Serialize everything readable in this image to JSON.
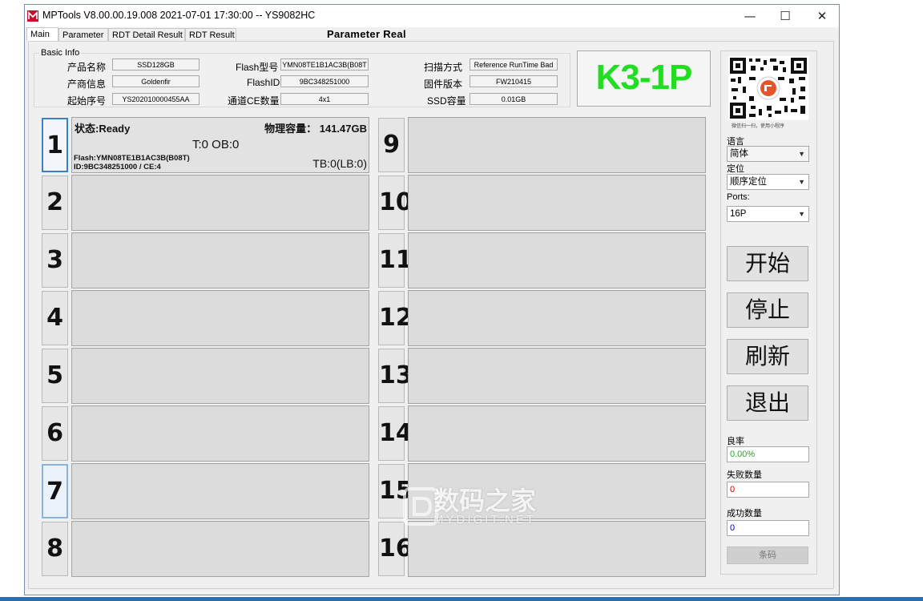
{
  "window": {
    "title": "MPTools V8.00.00.19.008 2021-07-01 17:30:00  -- YS9082HC",
    "controls": {
      "minimize": "—",
      "maximize": "☐",
      "close": "✕"
    }
  },
  "tabs": [
    {
      "label": "Main"
    },
    {
      "label": "Parameter"
    },
    {
      "label": "RDT Detail Result"
    },
    {
      "label": "RDT Result"
    }
  ],
  "header_caption": "Parameter  Real",
  "basic_info": {
    "legend": "Basic Info",
    "product_name_label": "产品名称",
    "product_name": "SSD128GB",
    "vendor_label": "产商信息",
    "vendor": "Goldenfir",
    "start_sn_label": "起始序号",
    "start_sn": "YS202010000455AA",
    "flash_type_label": "Flash型号",
    "flash_type": "YMN08TE1B1AC3B(B08T",
    "flash_id_label": "FlashID",
    "flash_id": "9BC348251000",
    "ce_label": "通道CE数量",
    "ce": "4x1",
    "scan_label": "扫描方式",
    "scan": "Reference RunTime Bad",
    "fw_label": "固件版本",
    "fw": "FW210415",
    "ssd_cap_label": "SSD容量",
    "ssd_cap": "0.01GB"
  },
  "model": "K3-1P",
  "ports_left": [
    "1",
    "2",
    "3",
    "4",
    "5",
    "6",
    "7",
    "8"
  ],
  "ports_right": [
    "9",
    "10",
    "11",
    "12",
    "13",
    "14",
    "15",
    "16"
  ],
  "port1": {
    "status": "状态:Ready",
    "capacity": "物理容量： 141.47GB",
    "t_ob": "T:0 OB:0",
    "flash": "Flash:YMN08TE1B1AC3B(B08T)",
    "id": "ID:9BC348251000 / CE:4",
    "tb": "TB:0(LB:0)"
  },
  "qr_caption": "微信扫一扫，使用小程序",
  "side": {
    "language_label": "语言",
    "language_value": "简体",
    "position_label": "定位",
    "position_value": "顺序定位",
    "ports_label": "Ports:",
    "ports_value": "16P",
    "start": "开始",
    "stop": "停止",
    "refresh": "刷新",
    "exit": "退出",
    "yield_label": "良率",
    "yield_value": "0.00%",
    "fail_label": "失败数量",
    "fail_value": "0",
    "success_label": "成功数量",
    "success_value": "0",
    "barcode": "条码"
  },
  "watermark": {
    "cn": "数码之家",
    "en": "MYDIGIT.NET"
  },
  "colors": {
    "model_green": "#22dd22",
    "yield_green": "#22aa22",
    "fail_red": "#dd0000",
    "success_blue": "#0000cc",
    "selected_port_border": "#3c7fc4"
  }
}
